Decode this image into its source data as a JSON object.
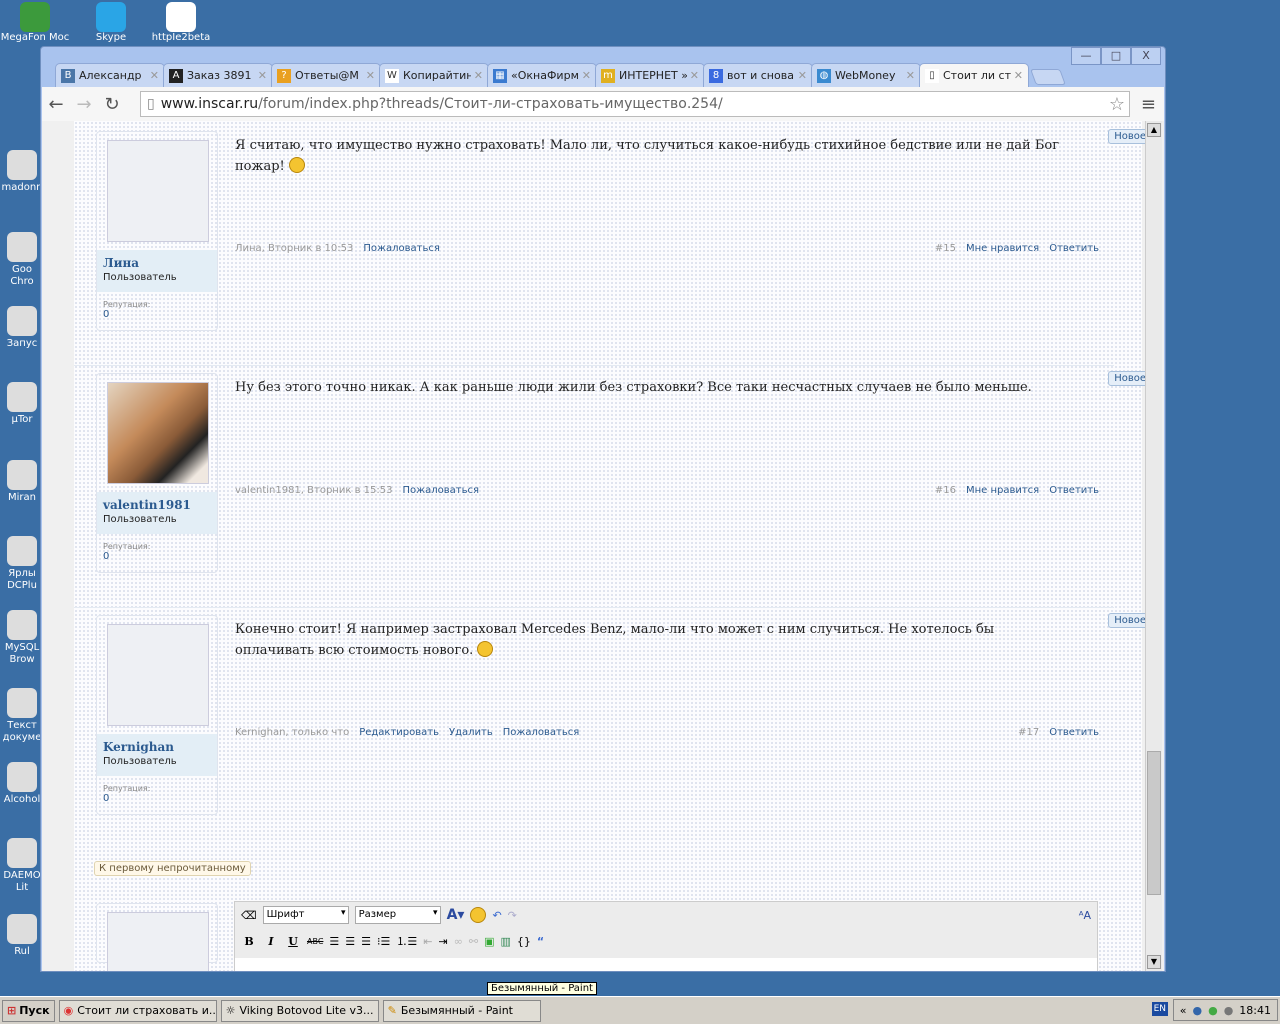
{
  "desktop": {
    "top_icons": [
      "MegaFon Moc",
      "Skype",
      "httpIe2beta"
    ],
    "left_icons": [
      "madonn",
      "Goo Chro",
      "Запус",
      "µTor",
      "Miran",
      "Ярлы DCPlu",
      "MySQL Brow",
      "Текст докуме",
      "Alcohol",
      "DAEMO Lit",
      "Rul"
    ]
  },
  "browser": {
    "window_buttons": [
      "—",
      "□",
      "X"
    ],
    "tabs": [
      {
        "label": "Александр",
        "icon": "B"
      },
      {
        "label": "Заказ 3891",
        "icon": "A"
      },
      {
        "label": "Ответы@М",
        "icon": "?"
      },
      {
        "label": "Копирайтин",
        "icon": "W"
      },
      {
        "label": "«ОкнаФирм",
        "icon": "▦"
      },
      {
        "label": "ИНТЕРНЕТ »",
        "icon": "m"
      },
      {
        "label": "вот и снова",
        "icon": "8"
      },
      {
        "label": "WebMoney",
        "icon": "◍"
      },
      {
        "label": "Стоит ли ст",
        "icon": "▯"
      }
    ],
    "url_host": "www.inscar.ru",
    "url_path": "/forum/index.php?threads/Стоит-ли-страховать-имущество.254/"
  },
  "posts": [
    {
      "user": "Лина",
      "role": "Пользователь",
      "rep_label": "Репутация:",
      "rep": "0",
      "text": "Я считаю, что имущество нужно страховать! Мало ли, что случиться какое-нибудь стихийное бедствие или не дай Бог пожар!",
      "meta": "Лина, Вторник в 10:53",
      "links": [
        "Пожаловаться"
      ],
      "num": "#15",
      "like": "Мне нравится",
      "reply": "Ответить",
      "badge": "Новое"
    },
    {
      "user": "valentin1981",
      "role": "Пользователь",
      "rep_label": "Репутация:",
      "rep": "0",
      "text": "Ну без этого точно никак. А как раньше люди жили без страховки? Все таки несчастных случаев не было меньше.",
      "meta": "valentin1981, Вторник в 15:53",
      "links": [
        "Пожаловаться"
      ],
      "num": "#16",
      "like": "Мне нравится",
      "reply": "Ответить",
      "badge": "Новое"
    },
    {
      "user": "Kernighan",
      "role": "Пользователь",
      "rep_label": "Репутация:",
      "rep": "0",
      "text": "Конечно стоит! Я например застраховал Mercedes Benz, мало-ли что может с ним случиться. Не хотелось бы оплачивать всю стоимость нового.",
      "meta": "Kernighan, только что",
      "links": [
        "Редактировать",
        "Удалить",
        "Пожаловаться"
      ],
      "num": "#17",
      "reply": "Ответить",
      "badge": "Новое"
    }
  ],
  "unread_link": "К первому непрочитанному",
  "editor": {
    "font": "Шрифт",
    "size": "Размер",
    "bold": "B",
    "italic": "I",
    "underline": "U",
    "strike": "ABC"
  },
  "taskbar": {
    "start": "Пуск",
    "tasks": [
      "Стоит ли страховать и...",
      "Viking Botovod Lite     v3...",
      "Безымянный - Paint"
    ],
    "tooltip": "Безымянный - Paint",
    "lang": "EN",
    "time": "18:41"
  }
}
